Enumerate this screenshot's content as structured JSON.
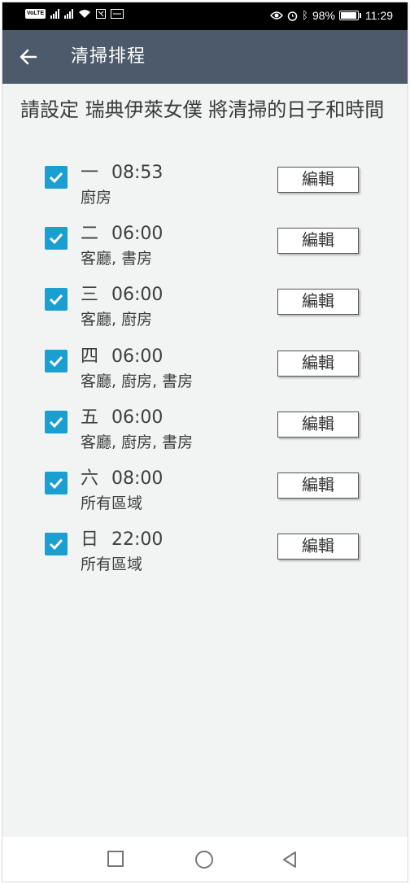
{
  "status_bar": {
    "volte": "VoLTE",
    "battery_level": 0.98,
    "battery_text": "98%",
    "time": "11:29"
  },
  "app_bar": {
    "back_icon": "arrow-left-icon",
    "title": "清掃排程"
  },
  "instruction": "請設定 瑞典伊萊女僕 將清掃的日子和時間",
  "schedule": [
    {
      "day": "一",
      "time": "08:53",
      "rooms": "廚房",
      "checked": true,
      "edit_label": "編輯"
    },
    {
      "day": "二",
      "time": "06:00",
      "rooms": "客廳, 書房",
      "checked": true,
      "edit_label": "編輯"
    },
    {
      "day": "三",
      "time": "06:00",
      "rooms": "客廳, 廚房",
      "checked": true,
      "edit_label": "編輯"
    },
    {
      "day": "四",
      "time": "06:00",
      "rooms": "客廳, 廚房, 書房",
      "checked": true,
      "edit_label": "編輯"
    },
    {
      "day": "五",
      "time": "06:00",
      "rooms": "客廳, 廚房, 書房",
      "checked": true,
      "edit_label": "編輯"
    },
    {
      "day": "六",
      "time": "08:00",
      "rooms": "所有區域",
      "checked": true,
      "edit_label": "編輯"
    },
    {
      "day": "日",
      "time": "22:00",
      "rooms": "所有區域",
      "checked": true,
      "edit_label": "編輯"
    }
  ],
  "nav_bar": {
    "icons": [
      "square-icon",
      "circle-icon",
      "triangle-back-icon"
    ]
  },
  "colors": {
    "app_bar": "#4c5a6b",
    "checkbox": "#1a9fd0",
    "background": "#f2f3f3"
  }
}
